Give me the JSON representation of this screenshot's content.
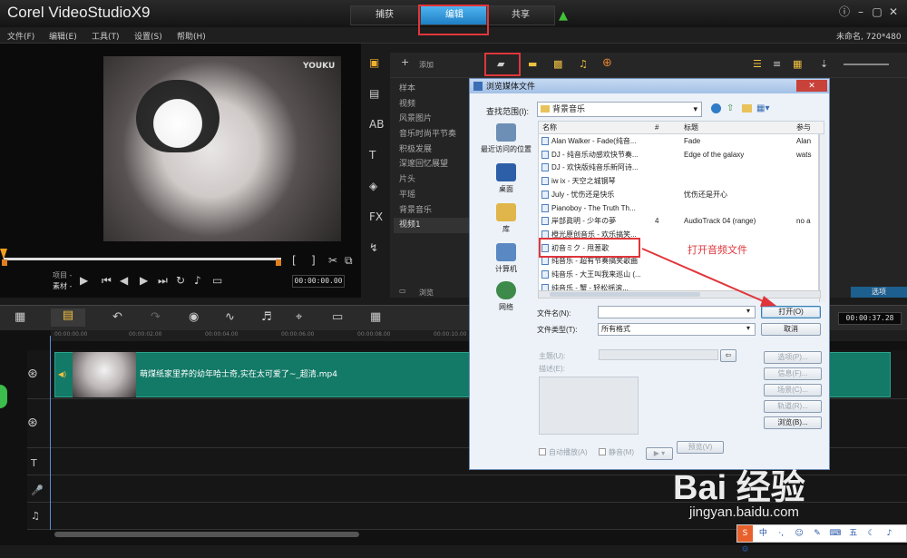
{
  "app": {
    "logo": "Corel VideoStudioX9",
    "project": "未命名, 720*480"
  },
  "steps": {
    "capture": "捕获",
    "edit": "编辑",
    "share": "共享"
  },
  "menu": [
    "文件(F)",
    "编辑(E)",
    "工具(T)",
    "设置(S)",
    "帮助(H)"
  ],
  "preview": {
    "watermark": "YOUKU",
    "project_label": "项目 -",
    "clip_label": "素材 -",
    "timecode": "00:00:00.00"
  },
  "library": {
    "add_label": "添加",
    "browse_label": "浏览",
    "options_label": "选项",
    "folders": [
      "样本",
      "视频",
      "风景图片",
      "音乐时尚平节奏",
      "积极发展",
      "深邃回忆展望",
      "片头",
      "平瑶",
      "背景音乐",
      "视频1"
    ]
  },
  "timeline": {
    "timecode": "00:00:37.28",
    "clip_name": "萌煤纸家里养的幼年哈士奇,实在太可爱了~_超清.mp4",
    "ruler": [
      "00:00:00.00",
      "00:00:02.00",
      "00:00:04.00",
      "00:00:06.00",
      "00:00:08.00",
      "00:00:10.00"
    ]
  },
  "dialog": {
    "title": "浏览媒体文件",
    "lookin_label": "查找范围(I):",
    "lookin_value": "背景音乐",
    "places": [
      "最近访问的位置",
      "桌面",
      "库",
      "计算机",
      "网络"
    ],
    "columns": {
      "name": "名称",
      "num": "#",
      "title": "标题",
      "artist": "参与"
    },
    "files": [
      {
        "name": "Alan Walker - Fade(纯音...",
        "num": "",
        "title": "Fade",
        "artist": "Alan"
      },
      {
        "name": "DJ - 纯音乐动感欢快节奏...",
        "num": "",
        "title": "Edge of the galaxy",
        "artist": "wats"
      },
      {
        "name": "DJ - 欢快版纯音乐新阿诗...",
        "num": "",
        "title": "",
        "artist": ""
      },
      {
        "name": "iw ix - 天空之城钢琴",
        "num": "",
        "title": "",
        "artist": ""
      },
      {
        "name": "July - 忧伤还是快乐",
        "num": "",
        "title": "忧伤还是开心",
        "artist": ""
      },
      {
        "name": "Pianoboy - The Truth Th...",
        "num": "",
        "title": "",
        "artist": ""
      },
      {
        "name": "岸部眞明 - 少年の夢",
        "num": "4",
        "title": "AudioTrack 04 (range)",
        "artist": "no a"
      },
      {
        "name": "橙光原创音乐 - 欢乐搞笑...",
        "num": "",
        "title": "",
        "artist": ""
      },
      {
        "name": "初音ミク - 甩葱歌",
        "num": "",
        "title": "",
        "artist": ""
      },
      {
        "name": "纯音乐 - 超有节奏搞笑歌曲",
        "num": "",
        "title": "",
        "artist": ""
      },
      {
        "name": "纯音乐 - 大王叫我来巡山 (...",
        "num": "",
        "title": "",
        "artist": ""
      },
      {
        "name": "纯音乐 - 蟹 - 轻松摇滚...",
        "num": "",
        "title": "",
        "artist": ""
      }
    ],
    "filename_label": "文件名(N):",
    "filename_value": "",
    "filetype_label": "文件类型(T):",
    "filetype_value": "所有格式",
    "open_label": "打开(O)",
    "cancel_label": "取消",
    "subject_label": "主题(U):",
    "desc_label": "描述(E):",
    "options_btn": "选项(P)...",
    "info_btn": "信息(F)...",
    "scene_btn": "场景(C)...",
    "track_btn": "轨道(R)...",
    "browse_btn": "浏览(B)...",
    "autoplay_label": "自动播放(A)",
    "mute_label": "静音(M)",
    "preview_btn": "预览(V)"
  },
  "annotation": "打开音频文件",
  "watermark": {
    "main": "Bai 经验",
    "sub": "jingyan.baidu.com"
  },
  "ime": [
    "S",
    "中",
    "·,",
    "☺",
    "✎",
    "⌨",
    "五",
    "☾",
    "♪",
    "⚙"
  ],
  "colors": {
    "accent": "#1e7fc4",
    "clip": "#137a67",
    "annotation": "#e0363b"
  }
}
